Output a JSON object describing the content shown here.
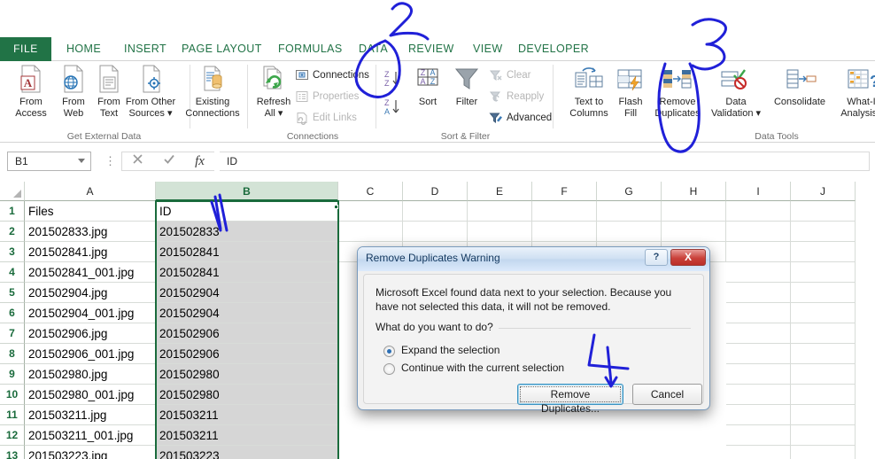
{
  "ribbon": {
    "tabs": [
      {
        "label": "FILE",
        "active": false
      },
      {
        "label": "HOME",
        "active": false
      },
      {
        "label": "INSERT",
        "active": false
      },
      {
        "label": "PAGE LAYOUT",
        "active": false
      },
      {
        "label": "FORMULAS",
        "active": false
      },
      {
        "label": "DATA",
        "active": true
      },
      {
        "label": "REVIEW",
        "active": false
      },
      {
        "label": "VIEW",
        "active": false
      },
      {
        "label": "DEVELOPER",
        "active": false
      }
    ],
    "groups": [
      {
        "title": "Get External Data"
      },
      {
        "title": "Connections"
      },
      {
        "title": "Sort & Filter"
      },
      {
        "title": "Data Tools"
      }
    ],
    "get_external_data": [
      {
        "line1": "From",
        "line2": "Access",
        "icon": "from-access-icon"
      },
      {
        "line1": "From",
        "line2": "Web",
        "icon": "from-web-icon"
      },
      {
        "line1": "From",
        "line2": "Text",
        "icon": "from-text-icon"
      },
      {
        "line1": "From Other",
        "line2": "Sources",
        "icon": "from-other-sources-icon",
        "dropdown": true
      }
    ],
    "existing_connections": {
      "line1": "Existing",
      "line2": "Connections",
      "icon": "existing-connections-icon"
    },
    "connections": {
      "refresh": {
        "line1": "Refresh",
        "line2": "All",
        "icon": "refresh-all-icon",
        "dropdown": true
      },
      "items": [
        {
          "label": "Connections",
          "icon": "connections-icon",
          "disabled": false
        },
        {
          "label": "Properties",
          "icon": "properties-icon",
          "disabled": true
        },
        {
          "label": "Edit Links",
          "icon": "edit-links-icon",
          "disabled": true
        }
      ]
    },
    "sort_filter": {
      "sort_az": "sort-ascending-icon",
      "sort_za": "sort-descending-icon",
      "sort": {
        "label": "Sort",
        "icon": "sort-dialog-icon"
      },
      "filter": {
        "label": "Filter",
        "icon": "filter-icon"
      },
      "items": [
        {
          "label": "Clear",
          "icon": "clear-filter-icon",
          "disabled": true
        },
        {
          "label": "Reapply",
          "icon": "reapply-filter-icon",
          "disabled": true
        },
        {
          "label": "Advanced",
          "icon": "advanced-filter-icon",
          "disabled": false
        }
      ]
    },
    "data_tools": [
      {
        "line1": "Text to",
        "line2": "Columns",
        "icon": "text-to-columns-icon",
        "dropdown": false
      },
      {
        "line1": "Flash",
        "line2": "Fill",
        "icon": "flash-fill-icon",
        "dropdown": false
      },
      {
        "line1": "Remove",
        "line2": "Duplicates",
        "icon": "remove-duplicates-icon",
        "dropdown": false
      },
      {
        "line1": "Data",
        "line2": "Validation",
        "icon": "data-validation-icon",
        "dropdown": true
      },
      {
        "line1": "Consolidate",
        "line2": "",
        "icon": "consolidate-icon",
        "dropdown": false
      },
      {
        "line1": "What-If",
        "line2": "Analysis",
        "icon": "what-if-analysis-icon",
        "dropdown": true
      }
    ]
  },
  "formula_bar": {
    "name_box_value": "B1",
    "cancel_icon": "cancel-icon",
    "enter_icon": "enter-icon",
    "fx_icon": "insert-function-icon",
    "formula_value": "ID"
  },
  "grid": {
    "columns": [
      "A",
      "B",
      "C",
      "D",
      "E",
      "F",
      "G",
      "H",
      "I",
      "J"
    ],
    "selected_column": "B",
    "rows": [
      "1",
      "2",
      "3",
      "4",
      "5",
      "6",
      "7",
      "8",
      "9",
      "10",
      "11",
      "12",
      "13"
    ],
    "cells": [
      {
        "a": "Files",
        "b": "ID"
      },
      {
        "a": "201502833.jpg",
        "b": "201502833"
      },
      {
        "a": "201502841.jpg",
        "b": "201502841"
      },
      {
        "a": "201502841_001.jpg",
        "b": "201502841"
      },
      {
        "a": "201502904.jpg",
        "b": "201502904"
      },
      {
        "a": "201502904_001.jpg",
        "b": "201502904"
      },
      {
        "a": "201502906.jpg",
        "b": "201502906"
      },
      {
        "a": "201502906_001.jpg",
        "b": "201502906"
      },
      {
        "a": "201502980.jpg",
        "b": "201502980"
      },
      {
        "a": "201502980_001.jpg",
        "b": "201502980"
      },
      {
        "a": "201503211.jpg",
        "b": "201503211"
      },
      {
        "a": "201503211_001.jpg",
        "b": "201503211"
      },
      {
        "a": "201503223.jpg",
        "b": "201503223"
      }
    ]
  },
  "dialog": {
    "title": "Remove Duplicates Warning",
    "help_label": "?",
    "close_label": "X",
    "message": "Microsoft Excel found data next to your selection. Because you have not selected this data, it will not be removed.",
    "question": "What do you want to do?",
    "options": [
      {
        "label": "Expand the selection",
        "selected": true
      },
      {
        "label": "Continue with the current selection",
        "selected": false
      }
    ],
    "ok_label": "Remove Duplicates...",
    "cancel_label": "Cancel"
  },
  "annotations": [
    {
      "name": "annotation-1",
      "text": "1"
    },
    {
      "name": "annotation-2",
      "text": "2"
    },
    {
      "name": "annotation-3",
      "text": "3"
    },
    {
      "name": "annotation-4",
      "text": "4"
    }
  ],
  "colors": {
    "excel_green": "#217346",
    "ink_blue": "#2020d8",
    "selection_grey": "#d6d6d6",
    "header_select": "#d3e3d6"
  }
}
